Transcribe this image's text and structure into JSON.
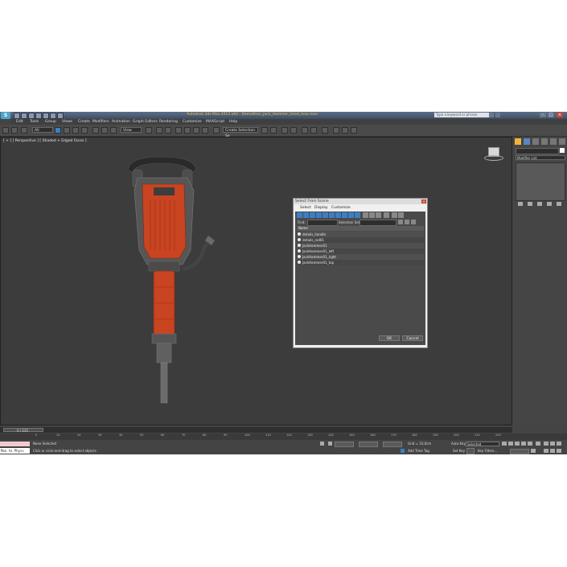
{
  "window": {
    "title": "Autodesk 3ds Max 2013 x64 - Demolition_Jack_Hammer_Used_max.max",
    "search_placeholder": "Type a keyword or phrase",
    "app_logo": "S"
  },
  "menu": [
    "Edit",
    "Tools",
    "Group",
    "Views",
    "Create",
    "Modifiers",
    "Animation",
    "Graph Editors",
    "Rendering",
    "Customize",
    "MAXScript",
    "Help"
  ],
  "toolbar": {
    "selection_filter": "All",
    "ref_coord": "View",
    "named_selection": "Create Selection Se"
  },
  "viewport": {
    "label": "[ + ] [ Perspective ] [ Shaded + Edged Faces ]"
  },
  "command_panel": {
    "modifier_list": "Modifier List"
  },
  "dialog": {
    "title": "Select From Scene",
    "menu": [
      "Select",
      "Display",
      "Customize"
    ],
    "find_label": "Find:",
    "selection_set_label": "Selection Set:",
    "column_header": "Name",
    "items": [
      "details_handle",
      "details_rod01",
      "JackHammer01",
      "JackHammer01_left",
      "JackHammer01_right",
      "JackHammer01_top"
    ],
    "ok": "OK",
    "cancel": "Cancel"
  },
  "timeline": {
    "frame": "0 / 225",
    "ticks": [
      "0",
      "10",
      "20",
      "30",
      "40",
      "50",
      "60",
      "70",
      "80",
      "90",
      "100",
      "110",
      "120",
      "130",
      "140",
      "150",
      "160",
      "170",
      "180",
      "190",
      "200",
      "210",
      "220"
    ]
  },
  "status": {
    "maxscript": "Max to Physc",
    "selection": "None Selected",
    "prompt": "Click or click-and-drag to select objects",
    "grid": "Grid = 10,0cm",
    "add_time_tag": "Add Time Tag",
    "auto_key": "Auto Key",
    "auto_key_value": "Selected",
    "set_key": "Set Key",
    "key_filters": "Key Filters..."
  },
  "colors": {
    "title_text": "#f0c040",
    "accent": "#3c7fc4",
    "model_red": "#c94420"
  }
}
